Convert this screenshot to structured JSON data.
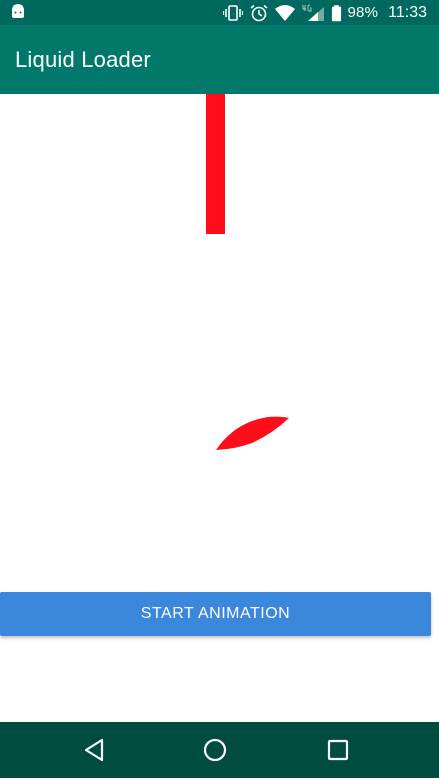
{
  "status_bar": {
    "battery_percent": "98%",
    "time": "11:33",
    "icons": [
      "android-icon",
      "vibrate-icon",
      "alarm-icon",
      "wifi-icon",
      "4g-signal-icon",
      "battery-icon"
    ]
  },
  "app_bar": {
    "title": "Liquid Loader"
  },
  "content": {
    "liquid_color": "#ff0d1a"
  },
  "actions": {
    "start_label": "START ANIMATION"
  },
  "nav_bar": {
    "icons": [
      "back-icon",
      "home-icon",
      "recents-icon"
    ]
  },
  "colors": {
    "status_bar": "#00695f",
    "app_bar": "#00796b",
    "button": "#3a87dc",
    "nav_bar": "#004d40"
  }
}
